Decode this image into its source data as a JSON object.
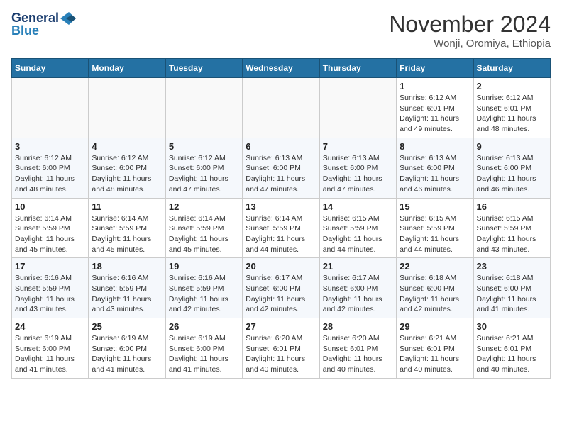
{
  "header": {
    "logo_line1": "General",
    "logo_line2": "Blue",
    "month": "November 2024",
    "location": "Wonji, Oromiya, Ethiopia"
  },
  "weekdays": [
    "Sunday",
    "Monday",
    "Tuesday",
    "Wednesday",
    "Thursday",
    "Friday",
    "Saturday"
  ],
  "weeks": [
    [
      {
        "day": "",
        "info": ""
      },
      {
        "day": "",
        "info": ""
      },
      {
        "day": "",
        "info": ""
      },
      {
        "day": "",
        "info": ""
      },
      {
        "day": "",
        "info": ""
      },
      {
        "day": "1",
        "info": "Sunrise: 6:12 AM\nSunset: 6:01 PM\nDaylight: 11 hours\nand 49 minutes."
      },
      {
        "day": "2",
        "info": "Sunrise: 6:12 AM\nSunset: 6:01 PM\nDaylight: 11 hours\nand 48 minutes."
      }
    ],
    [
      {
        "day": "3",
        "info": "Sunrise: 6:12 AM\nSunset: 6:00 PM\nDaylight: 11 hours\nand 48 minutes."
      },
      {
        "day": "4",
        "info": "Sunrise: 6:12 AM\nSunset: 6:00 PM\nDaylight: 11 hours\nand 48 minutes."
      },
      {
        "day": "5",
        "info": "Sunrise: 6:12 AM\nSunset: 6:00 PM\nDaylight: 11 hours\nand 47 minutes."
      },
      {
        "day": "6",
        "info": "Sunrise: 6:13 AM\nSunset: 6:00 PM\nDaylight: 11 hours\nand 47 minutes."
      },
      {
        "day": "7",
        "info": "Sunrise: 6:13 AM\nSunset: 6:00 PM\nDaylight: 11 hours\nand 47 minutes."
      },
      {
        "day": "8",
        "info": "Sunrise: 6:13 AM\nSunset: 6:00 PM\nDaylight: 11 hours\nand 46 minutes."
      },
      {
        "day": "9",
        "info": "Sunrise: 6:13 AM\nSunset: 6:00 PM\nDaylight: 11 hours\nand 46 minutes."
      }
    ],
    [
      {
        "day": "10",
        "info": "Sunrise: 6:14 AM\nSunset: 5:59 PM\nDaylight: 11 hours\nand 45 minutes."
      },
      {
        "day": "11",
        "info": "Sunrise: 6:14 AM\nSunset: 5:59 PM\nDaylight: 11 hours\nand 45 minutes."
      },
      {
        "day": "12",
        "info": "Sunrise: 6:14 AM\nSunset: 5:59 PM\nDaylight: 11 hours\nand 45 minutes."
      },
      {
        "day": "13",
        "info": "Sunrise: 6:14 AM\nSunset: 5:59 PM\nDaylight: 11 hours\nand 44 minutes."
      },
      {
        "day": "14",
        "info": "Sunrise: 6:15 AM\nSunset: 5:59 PM\nDaylight: 11 hours\nand 44 minutes."
      },
      {
        "day": "15",
        "info": "Sunrise: 6:15 AM\nSunset: 5:59 PM\nDaylight: 11 hours\nand 44 minutes."
      },
      {
        "day": "16",
        "info": "Sunrise: 6:15 AM\nSunset: 5:59 PM\nDaylight: 11 hours\nand 43 minutes."
      }
    ],
    [
      {
        "day": "17",
        "info": "Sunrise: 6:16 AM\nSunset: 5:59 PM\nDaylight: 11 hours\nand 43 minutes."
      },
      {
        "day": "18",
        "info": "Sunrise: 6:16 AM\nSunset: 5:59 PM\nDaylight: 11 hours\nand 43 minutes."
      },
      {
        "day": "19",
        "info": "Sunrise: 6:16 AM\nSunset: 5:59 PM\nDaylight: 11 hours\nand 42 minutes."
      },
      {
        "day": "20",
        "info": "Sunrise: 6:17 AM\nSunset: 6:00 PM\nDaylight: 11 hours\nand 42 minutes."
      },
      {
        "day": "21",
        "info": "Sunrise: 6:17 AM\nSunset: 6:00 PM\nDaylight: 11 hours\nand 42 minutes."
      },
      {
        "day": "22",
        "info": "Sunrise: 6:18 AM\nSunset: 6:00 PM\nDaylight: 11 hours\nand 42 minutes."
      },
      {
        "day": "23",
        "info": "Sunrise: 6:18 AM\nSunset: 6:00 PM\nDaylight: 11 hours\nand 41 minutes."
      }
    ],
    [
      {
        "day": "24",
        "info": "Sunrise: 6:19 AM\nSunset: 6:00 PM\nDaylight: 11 hours\nand 41 minutes."
      },
      {
        "day": "25",
        "info": "Sunrise: 6:19 AM\nSunset: 6:00 PM\nDaylight: 11 hours\nand 41 minutes."
      },
      {
        "day": "26",
        "info": "Sunrise: 6:19 AM\nSunset: 6:00 PM\nDaylight: 11 hours\nand 41 minutes."
      },
      {
        "day": "27",
        "info": "Sunrise: 6:20 AM\nSunset: 6:01 PM\nDaylight: 11 hours\nand 40 minutes."
      },
      {
        "day": "28",
        "info": "Sunrise: 6:20 AM\nSunset: 6:01 PM\nDaylight: 11 hours\nand 40 minutes."
      },
      {
        "day": "29",
        "info": "Sunrise: 6:21 AM\nSunset: 6:01 PM\nDaylight: 11 hours\nand 40 minutes."
      },
      {
        "day": "30",
        "info": "Sunrise: 6:21 AM\nSunset: 6:01 PM\nDaylight: 11 hours\nand 40 minutes."
      }
    ]
  ]
}
